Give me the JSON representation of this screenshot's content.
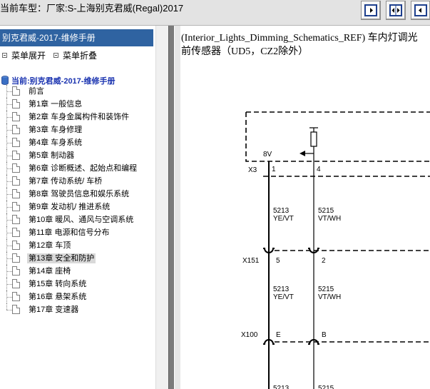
{
  "header": {
    "vehicle_label": "当前车型：厂家:S-上海别克君威(Regal)2017",
    "buttons": [
      {
        "icon": "panel-left-icon"
      },
      {
        "icon": "panel-split-icon"
      },
      {
        "icon": "panel-right-icon"
      }
    ]
  },
  "sidebar": {
    "title": "别克君威-2017-维修手册",
    "expand_label": "菜单展开",
    "collapse_label": "菜单折叠",
    "root_label": "当前:别克君威-2017-维修手册",
    "items": [
      {
        "label": "前言"
      },
      {
        "label": "第1章 一般信息"
      },
      {
        "label": "第2章 车身金属构件和装饰件"
      },
      {
        "label": "第3章 车身修理"
      },
      {
        "label": "第4章 车身系统"
      },
      {
        "label": "第5章 制动器"
      },
      {
        "label": "第6章 诊断概述、起始点和编程"
      },
      {
        "label": "第7章 传动系统/ 车桥"
      },
      {
        "label": "第8章 驾驶员信息和娱乐系统"
      },
      {
        "label": "第9章 发动机/ 推进系统"
      },
      {
        "label": "第10章 暖风、通风与空调系统"
      },
      {
        "label": "第11章 电源和信号分布"
      },
      {
        "label": "第12章 车顶"
      },
      {
        "label": "第13章 安全和防护"
      },
      {
        "label": "第14章 座椅"
      },
      {
        "label": "第15章 转向系统"
      },
      {
        "label": "第16章 悬架系统"
      },
      {
        "label": "第17章 变速器"
      }
    ],
    "selected_index": 13
  },
  "content": {
    "line1": "(Interior_Lights_Dimming_Schematics_REF) 车内灯调光",
    "line2": "前传感器（UD5，CZ2除外）",
    "schematic": {
      "voltage": "8V",
      "connectors": [
        {
          "label": "X3",
          "pins": [
            "1",
            "4"
          ]
        },
        {
          "label": "X151",
          "pins": [
            "5",
            "2"
          ]
        },
        {
          "label": "X100",
          "pins": [
            "E",
            "B"
          ]
        }
      ],
      "wires": [
        {
          "circuit": "5213",
          "color": "YE/VT"
        },
        {
          "circuit": "5215",
          "color": "VT/WH"
        },
        {
          "circuit": "5213",
          "color": "YE/VT"
        },
        {
          "circuit": "5215",
          "color": "VT/WH"
        },
        {
          "circuit": "5213",
          "color": ""
        },
        {
          "circuit": "5215",
          "color": ""
        }
      ]
    }
  }
}
